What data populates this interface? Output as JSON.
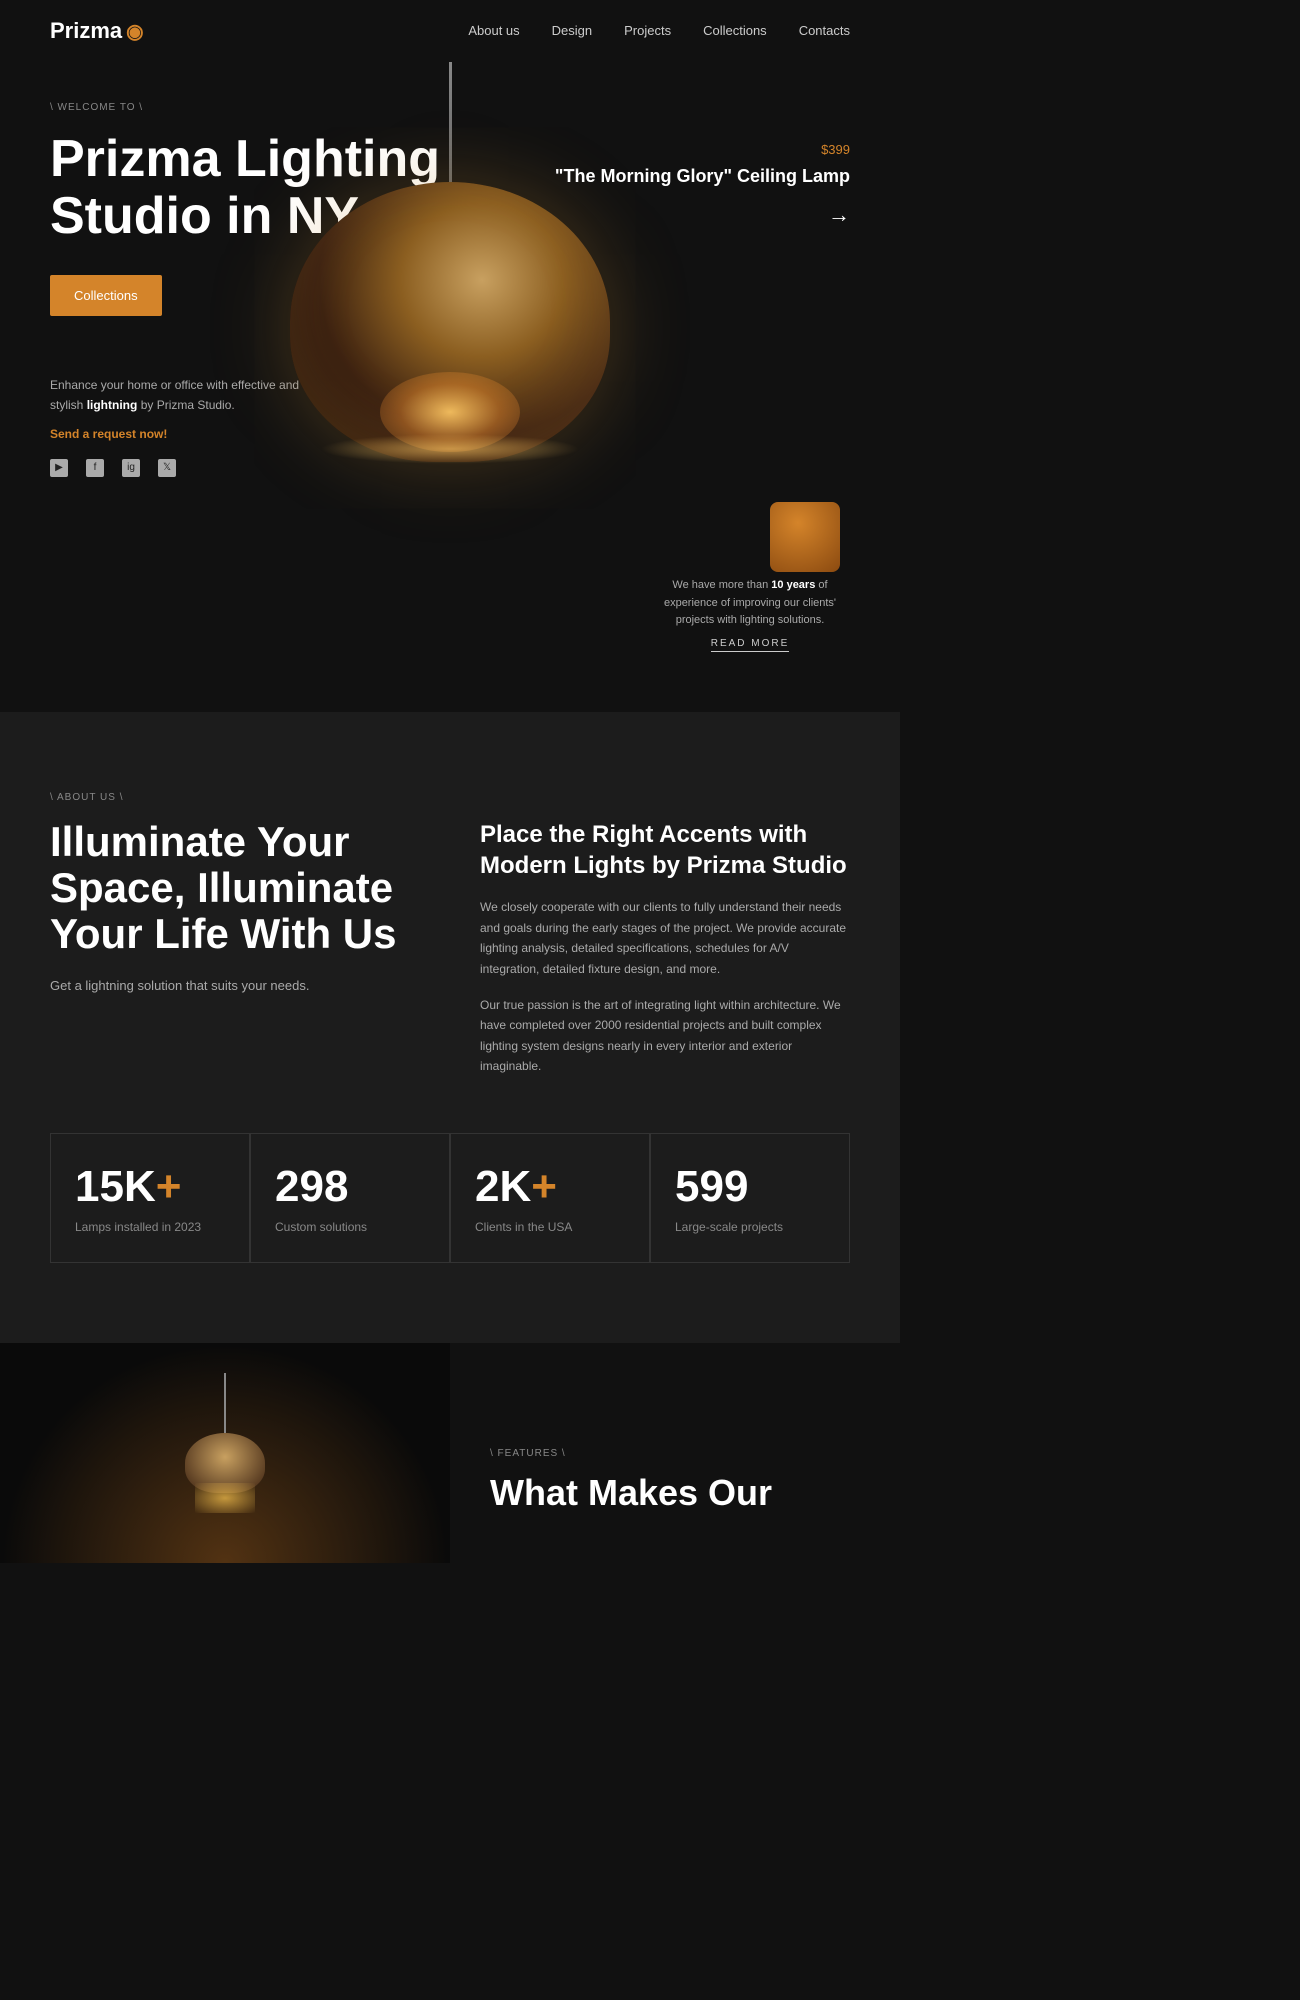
{
  "nav": {
    "logo": "Prizma",
    "logo_icon": "◉",
    "links": [
      {
        "label": "About us",
        "href": "#"
      },
      {
        "label": "Design",
        "href": "#"
      },
      {
        "label": "Projects",
        "href": "#"
      },
      {
        "label": "Collections",
        "href": "#"
      },
      {
        "label": "Contacts",
        "href": "#"
      }
    ]
  },
  "hero": {
    "welcome": "\\ WELCOME TO \\",
    "title": "Prizma Lighting Studio in NY",
    "collections_btn": "Collections",
    "description": "Enhance your home or office with effective and stylish",
    "description_bold": "lightning",
    "description_suffix": " by Prizma Studio.",
    "request_link": "Send a request now!",
    "price": "$399",
    "product_name": "\"The Morning Glory\" Ceiling Lamp",
    "arrow": "→",
    "experience_text": "We have more than",
    "experience_bold": "10 years",
    "experience_suffix": " of experience of improving our clients' projects with lighting solutions.",
    "read_more": "READ MORE"
  },
  "about": {
    "label": "\\ ABOUT US \\",
    "title": "Illuminate Your Space, Illuminate Your Life With Us",
    "subtitle": "Get a lightning solution that suits your needs.",
    "right_title": "Place the Right Accents with Modern Lights by Prizma Studio",
    "text1": "We closely cooperate with our clients to fully understand their needs and goals during the early stages of the project. We provide accurate lighting analysis, detailed specifications, schedules for A/V integration, detailed fixture design, and more.",
    "text2": "Our true passion is the art of integrating light within architecture. We have completed over 2000 residential projects and built complex lighting system designs nearly in every interior and exterior imaginable.",
    "stats": [
      {
        "number": "15K",
        "plus": "+",
        "label": "Lamps installed in 2023"
      },
      {
        "number": "298",
        "plus": "",
        "label": "Custom solutions"
      },
      {
        "number": "2K",
        "plus": "+",
        "label": "Clients in the USA"
      },
      {
        "number": "599",
        "plus": "",
        "label": "Large-scale projects"
      }
    ]
  },
  "features": {
    "label": "\\ FEATURES \\",
    "title": "What Makes Our"
  }
}
